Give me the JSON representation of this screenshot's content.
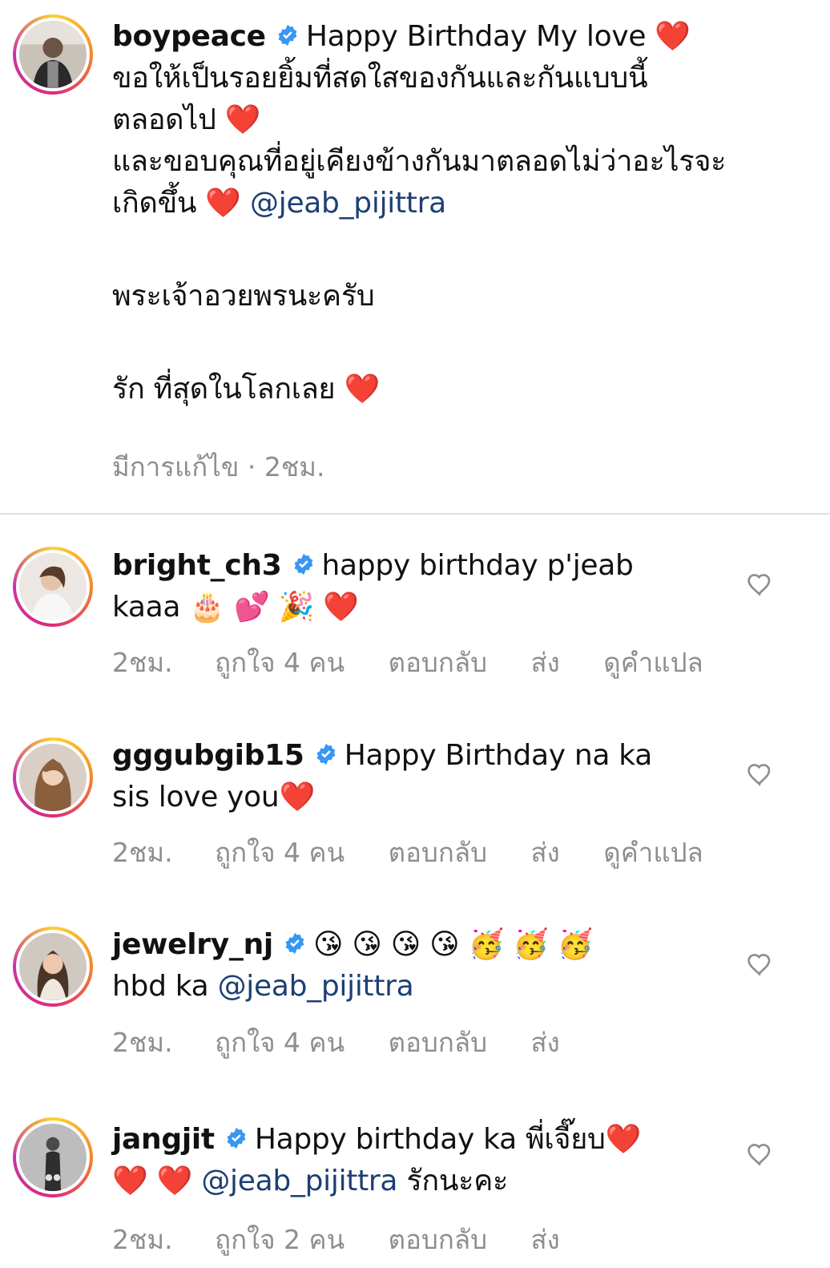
{
  "post": {
    "username": "boypeace",
    "line1": "Happy Birthday  My love",
    "line2": "ขอให้เป็นรอยยิ้มที่สดใสของกันและกันแบบนี้",
    "line3": "ตลอดไป",
    "line4": "และขอบคุณที่อยู่เคียงข้างกันมาตลอดไม่ว่าอะไรจะ",
    "line5": "เกิดขึ้น",
    "mention": "@jeab_pijittra",
    "line6": "พระเจ้าอวยพรนะครับ",
    "line7": "รัก ที่สุดในโลกเลย",
    "edited": "มีการแก้ไข",
    "separator": "·",
    "time": "2ชม.",
    "heart": "❤️"
  },
  "comments": [
    {
      "username": "bright_ch3",
      "text1": "happy birthday p'jeab",
      "text2": "kaaa",
      "emoji": "🎂 💕 🎉 ❤️",
      "time": "2ชม.",
      "likes": "ถูกใจ 4 คน",
      "reply": "ตอบกลับ",
      "send": "ส่ง",
      "translate": "ดูคำแปล"
    },
    {
      "username": "gggubgib15",
      "text1": "Happy Birthday na ka",
      "text2": "sis love you",
      "emoji": "❤️",
      "time": "2ชม.",
      "likes": "ถูกใจ 4 คน",
      "reply": "ตอบกลับ",
      "send": "ส่ง",
      "translate": "ดูคำแปล"
    },
    {
      "username": "jewelry_nj",
      "emoji": "😘 😘 😘 😘 🥳 🥳 🥳",
      "text2": "hbd ka",
      "mention": "@jeab_pijittra",
      "time": "2ชม.",
      "likes": "ถูกใจ 4 คน",
      "reply": "ตอบกลับ",
      "send": "ส่ง"
    },
    {
      "username": "jangjit",
      "text1": "Happy birthday ka พี่เจี๊ยบ",
      "heart": "❤️",
      "hearts2": "❤️ ❤️",
      "mention": "@jeab_pijittra",
      "text2": "รักนะคะ",
      "time": "2ชม.",
      "likes": "ถูกใจ 2 คน",
      "reply": "ตอบกลับ",
      "send": "ส่ง"
    }
  ],
  "icons": {
    "verified": "verified-badge-icon",
    "like": "heart-outline-icon"
  },
  "colors": {
    "mention": "#1d3f73",
    "verified": "#3897f0",
    "meta": "#8e8e8e",
    "heart": "#e01b2d"
  }
}
